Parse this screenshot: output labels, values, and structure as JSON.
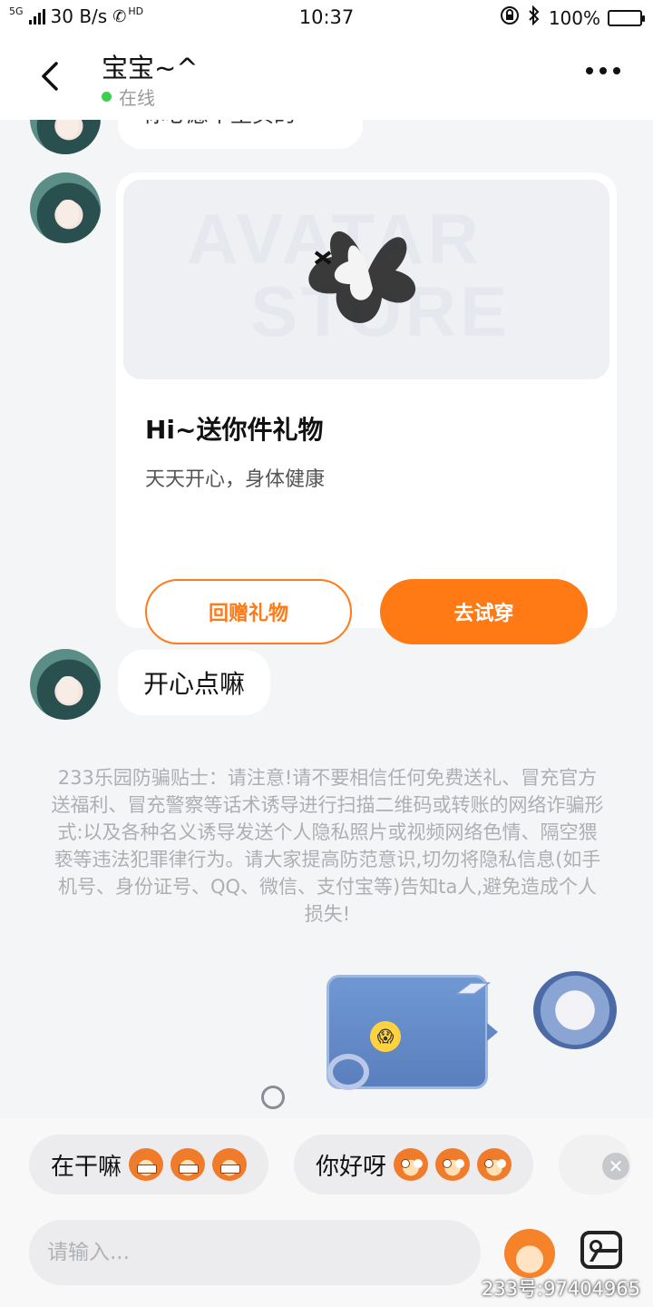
{
  "status_bar": {
    "network": "5G",
    "speed": "30 B/s",
    "hd": "HD",
    "time": "10:37",
    "battery": "100%"
  },
  "header": {
    "title": "宝宝~^",
    "status": "在线"
  },
  "chat": {
    "partial_message": "你心愿单里买的",
    "gift_card": {
      "watermark": [
        "AVATAR",
        "STORE"
      ],
      "title": "Hi~送你件礼物",
      "subtitle": "天天开心，身体健康",
      "reply_button": "回赠礼物",
      "try_button": "去试穿"
    },
    "message": "开心点嘛",
    "notice": "233乐园防骗贴士：请注意!请不要相信任何免费送礼、冒充官方送福利、冒充警察等话术诱导进行扫描二维码或转账的网络诈骗形式:以及各种名义诱导发送个人隐私照片或视频网络色情、隔空猥亵等违法犯罪律行为。请大家提高防范意识,切勿将隐私信息(如手机号、身份证号、QQ、微信、支付宝等)告知ta人,避免造成个人损失!"
  },
  "quick_replies": [
    {
      "text": "在干嘛",
      "emoji": "grinning-monkey-icon"
    },
    {
      "text": "你好呀",
      "emoji": "happy-monkey-icon"
    }
  ],
  "input": {
    "placeholder": "请输入..."
  },
  "watermark_id": "233号:97404965"
}
